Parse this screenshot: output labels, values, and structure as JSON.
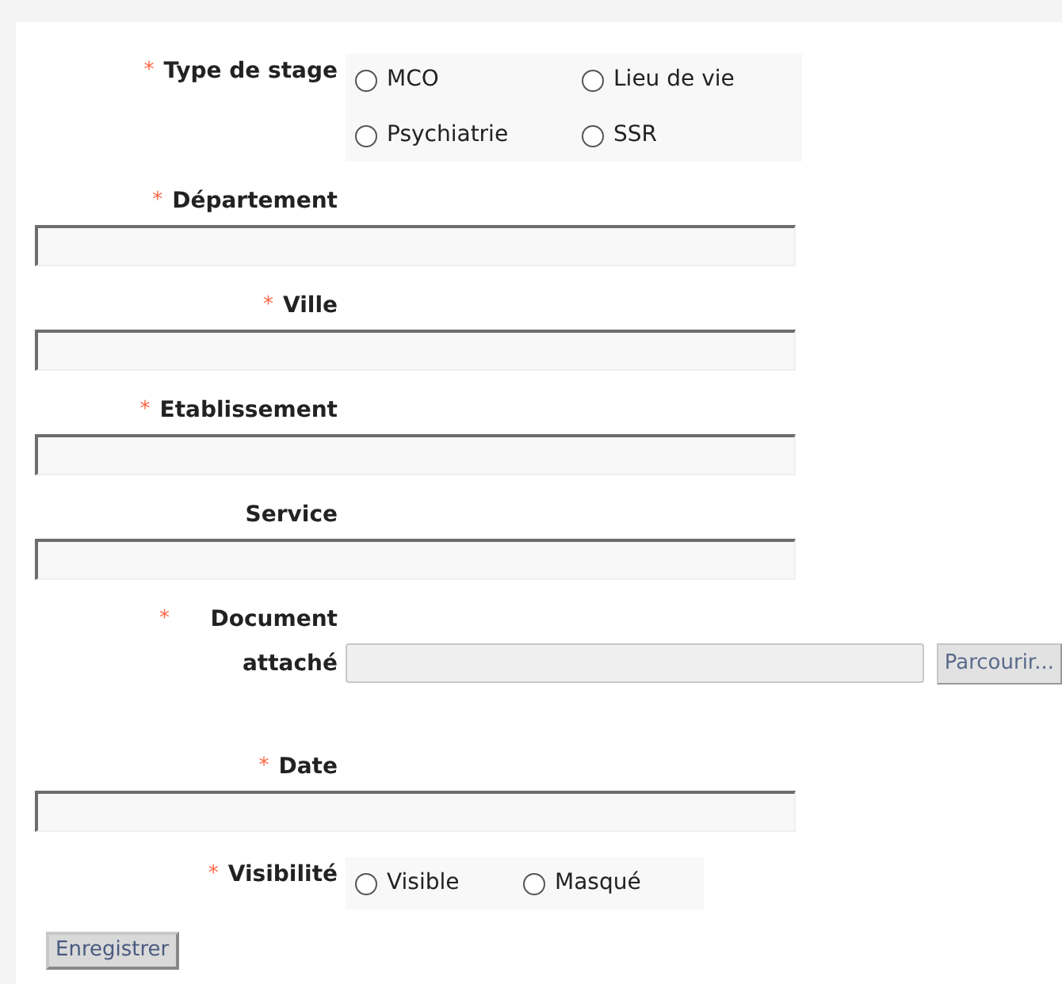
{
  "fields": [
    {
      "kind": "radio",
      "label": "Type de stage",
      "required": "*",
      "options": [
        {
          "label": "MCO",
          "selected": false
        },
        {
          "label": "Lieu de vie",
          "selected": false
        },
        {
          "label": "Psychiatrie",
          "selected": false
        },
        {
          "label": "SSR",
          "selected": false
        }
      ]
    },
    {
      "kind": "text",
      "label": "Département",
      "required": "*"
    },
    {
      "kind": "text",
      "label": "Ville",
      "required": "*"
    },
    {
      "kind": "text",
      "label": "Etablissement",
      "required": "*"
    },
    {
      "kind": "text",
      "label": "Service"
    },
    {
      "kind": "file",
      "label": "Document attaché",
      "required": "*",
      "button": "Parcourir..."
    },
    {
      "kind": "text",
      "label": "Date",
      "required": "*"
    },
    {
      "kind": "radio",
      "label": "Visibilité",
      "required": "*",
      "options": [
        {
          "label": "Visible",
          "selected": false
        },
        {
          "label": "Masqué",
          "selected": false
        }
      ]
    }
  ],
  "submit": "Enregistrer"
}
